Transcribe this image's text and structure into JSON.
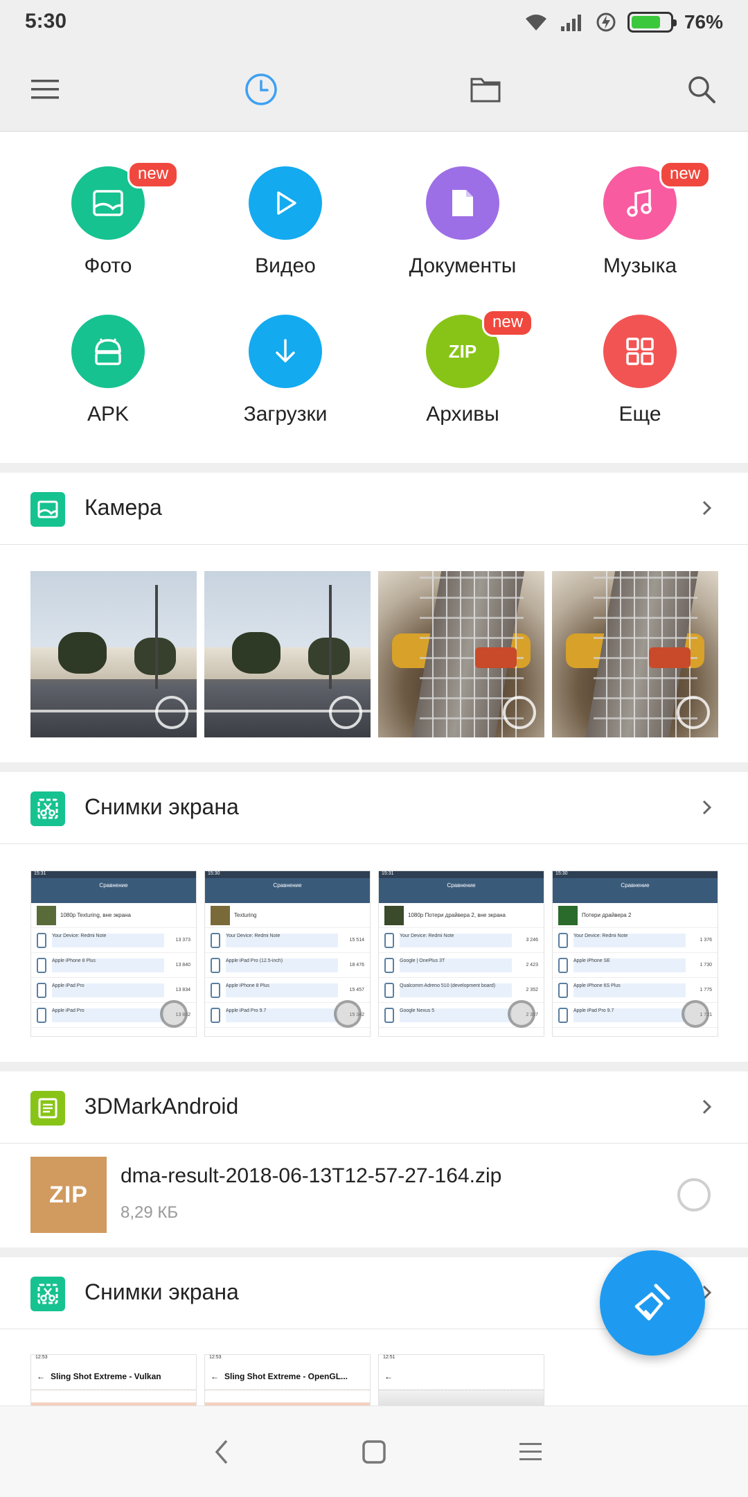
{
  "status_bar": {
    "time": "5:30",
    "battery_percent": "76%",
    "battery_level": 0.76
  },
  "app_bar": {
    "icons": [
      "menu-icon",
      "recent-clock-icon",
      "folder-icon",
      "search-icon"
    ],
    "active_color": "#3ea0f2"
  },
  "categories": [
    {
      "label": "Фото",
      "icon": "photo-icon",
      "color": "#16c290",
      "badge": "new"
    },
    {
      "label": "Видео",
      "icon": "play-icon",
      "color": "#13aaf0",
      "badge": ""
    },
    {
      "label": "Документы",
      "icon": "document-icon",
      "color": "#9d6fe6",
      "badge": ""
    },
    {
      "label": "Музыка",
      "icon": "music-note-icon",
      "color": "#f95ba0",
      "badge": "new"
    },
    {
      "label": "APK",
      "icon": "android-icon",
      "color": "#16c290",
      "badge": ""
    },
    {
      "label": "Загрузки",
      "icon": "download-arrow-icon",
      "color": "#13aaf0",
      "badge": ""
    },
    {
      "label": "Архивы",
      "icon": "zip-icon",
      "color": "#88c417",
      "badge": "new",
      "circle_text": "ZIP"
    },
    {
      "label": "Еще",
      "icon": "grid-icon",
      "color": "#f25454",
      "badge": ""
    }
  ],
  "sections": {
    "camera": {
      "title": "Камера",
      "icon_color": "#16c290"
    },
    "screenshots_1": {
      "title": "Снимки экрана",
      "icon_color": "#16c290",
      "thumbs": [
        {
          "time": "15:31",
          "header": "Сравнение",
          "title": "1080p Texturing, вне экрана",
          "rows": [
            "Your Device: Redmi Note",
            "Apple iPhone 8 Plus",
            "Apple iPad Pro",
            "Apple iPad Pro"
          ],
          "values": [
            "13 373",
            "13 840",
            "13 834",
            "13 832"
          ]
        },
        {
          "time": "15:30",
          "header": "Сравнение",
          "title": "Texturing",
          "rows": [
            "Your Device: Redmi Note",
            "Apple iPad Pro (12.5-inch)",
            "Apple iPhone 8 Plus",
            "Apple iPad Pro 9.7"
          ],
          "values": [
            "15 514",
            "18 476",
            "15 457",
            "15 342"
          ]
        },
        {
          "time": "15:31",
          "header": "Сравнение",
          "title": "1080p Потери драйвера 2, вне экрана",
          "rows": [
            "Your Device: Redmi Note",
            "Google | OnePlus 3T",
            "Qualcomm Adreno 510 (development board)",
            "Google Nexus 5"
          ],
          "values": [
            "3 246",
            "2 423",
            "2 352",
            "2 337"
          ]
        },
        {
          "time": "15:30",
          "header": "Сравнение",
          "title": "Потери драйвера 2",
          "rows": [
            "Your Device: Redmi Note",
            "Apple iPhone SE",
            "Apple iPhone 6S Plus",
            "Apple iPad Pro 9.7"
          ],
          "values": [
            "1 376",
            "1 730",
            "1 775",
            "1 721"
          ]
        }
      ]
    },
    "dmark": {
      "title": "3DMarkAndroid",
      "icon_color": "#88c417",
      "file": {
        "name": "dma-result-2018-06-13T12-57-27-164.zip",
        "size": "8,29 КБ",
        "thumb_text": "ZIP",
        "thumb_color": "#d19a5f"
      }
    },
    "screenshots_2": {
      "title": "Снимки экрана",
      "icon_color": "#16c290",
      "thumbs": [
        {
          "time": "12:53",
          "title": "Sling Shot Extreme - Vulkan"
        },
        {
          "time": "12:53",
          "title": "Sling Shot Extreme - OpenGL..."
        },
        {
          "time": "12:51",
          "title": ""
        }
      ]
    }
  },
  "fab": {
    "icon": "broom-clean-icon",
    "color": "#1e9bf0"
  },
  "nav_bar": {
    "icons": [
      "back-icon",
      "home-square-icon",
      "recents-menu-icon"
    ]
  }
}
